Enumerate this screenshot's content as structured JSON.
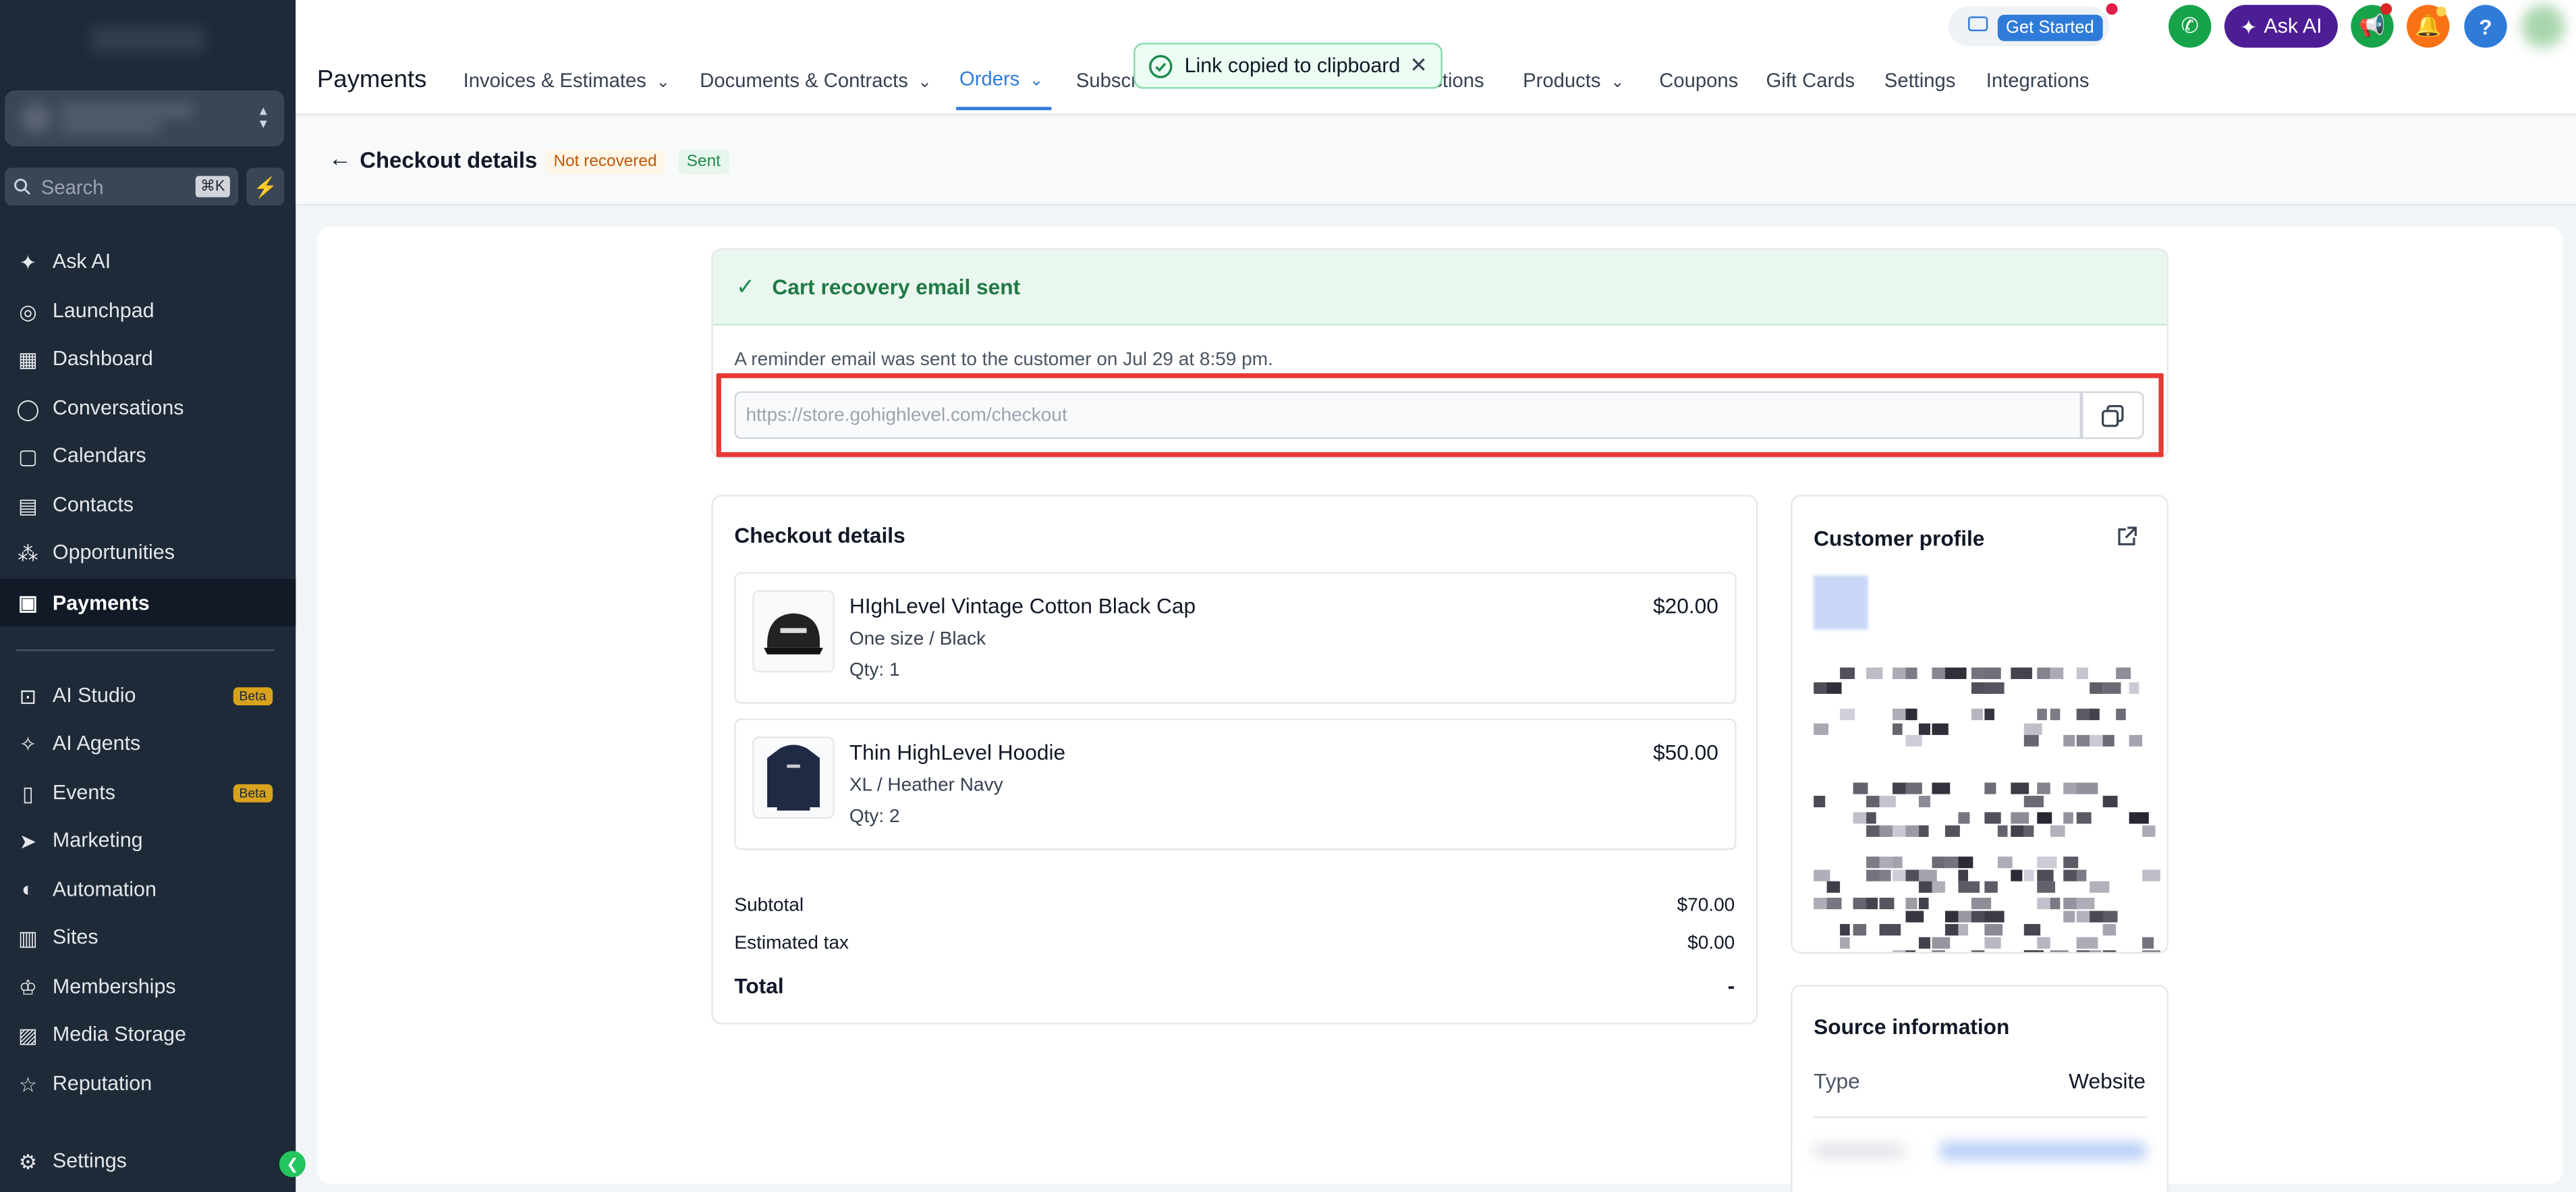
{
  "sidebar": {
    "search_placeholder": "Search",
    "search_shortcut": "⌘K",
    "items": [
      {
        "label": "Ask AI",
        "icon": "sparkle-icon"
      },
      {
        "label": "Launchpad",
        "icon": "rocket-icon"
      },
      {
        "label": "Dashboard",
        "icon": "grid-icon"
      },
      {
        "label": "Conversations",
        "icon": "chat-icon"
      },
      {
        "label": "Calendars",
        "icon": "calendar-icon"
      },
      {
        "label": "Contacts",
        "icon": "contacts-icon"
      },
      {
        "label": "Opportunities",
        "icon": "opportunities-icon"
      },
      {
        "label": "Payments",
        "icon": "payments-icon"
      },
      {
        "label": "AI Studio",
        "icon": "ai-studio-icon",
        "badge": "Beta"
      },
      {
        "label": "AI Agents",
        "icon": "ai-agents-icon"
      },
      {
        "label": "Events",
        "icon": "events-icon",
        "badge": "Beta"
      },
      {
        "label": "Marketing",
        "icon": "send-icon"
      },
      {
        "label": "Automation",
        "icon": "automation-icon"
      },
      {
        "label": "Sites",
        "icon": "sites-icon"
      },
      {
        "label": "Memberships",
        "icon": "memberships-icon"
      },
      {
        "label": "Media Storage",
        "icon": "image-icon"
      },
      {
        "label": "Reputation",
        "icon": "star-icon"
      },
      {
        "label": "Settings",
        "icon": "gear-icon"
      }
    ]
  },
  "header": {
    "app_title": "Payments",
    "tabs": [
      {
        "label": "Invoices & Estimates",
        "dropdown": true
      },
      {
        "label": "Documents & Contracts",
        "dropdown": true
      },
      {
        "label": "Orders",
        "dropdown": true,
        "active": true
      },
      {
        "label": "Subscri",
        "dropdown": false
      },
      {
        "label": "ctions",
        "dropdown": false
      },
      {
        "label": "Products",
        "dropdown": true
      },
      {
        "label": "Coupons",
        "dropdown": false
      },
      {
        "label": "Gift Cards",
        "dropdown": false
      },
      {
        "label": "Settings",
        "dropdown": false
      },
      {
        "label": "Integrations",
        "dropdown": false
      }
    ],
    "get_started": "Get Started",
    "ask_ai": "Ask AI",
    "help": "?"
  },
  "toast": {
    "message": "Link copied to clipboard"
  },
  "page": {
    "title": "Checkout details",
    "status_badge": "Not recovered",
    "email_badge": "Sent"
  },
  "recovery": {
    "heading": "Cart recovery email sent",
    "description": "A reminder email was sent to the customer on Jul 29 at 8:59 pm.",
    "link_placeholder": "https://store.gohighlevel.com/checkout"
  },
  "checkout": {
    "heading": "Checkout details",
    "items": [
      {
        "name": "HIghLevel Vintage Cotton Black Cap",
        "variant": "One size / Black",
        "qty": "Qty: 1",
        "price": "$20.00"
      },
      {
        "name": "Thin HighLevel Hoodie",
        "variant": "XL / Heather Navy",
        "qty": "Qty: 2",
        "price": "$50.00"
      }
    ],
    "subtotal_label": "Subtotal",
    "subtotal": "$70.00",
    "tax_label": "Estimated tax",
    "tax": "$0.00",
    "total_label": "Total",
    "total": "-"
  },
  "customer": {
    "heading": "Customer profile"
  },
  "source": {
    "heading": "Source information",
    "type_label": "Type",
    "type_value": "Website"
  },
  "colors": {
    "accent": "#2f7bd9",
    "success": "#1f8a4c",
    "warning": "#c2570c",
    "highlight": "#e53935",
    "sidebar": "#1e2a38"
  }
}
